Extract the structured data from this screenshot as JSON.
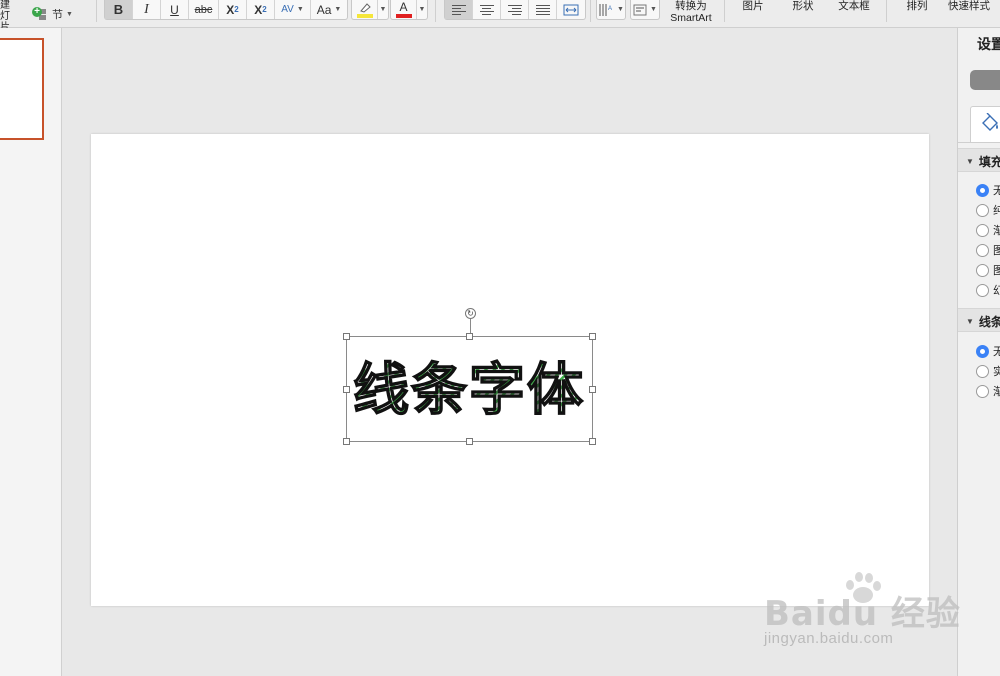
{
  "ribbon": {
    "new_slide_label_1": "建",
    "new_slide_label_2": "灯片",
    "section_label": "节",
    "format": {
      "bold": "B",
      "italic": "I",
      "underline": "U",
      "strikethrough": "abc",
      "superscript": "X",
      "superscript_mark": "2",
      "subscript": "X",
      "subscript_mark": "2",
      "char_spacing": "AV",
      "change_case": "Aa"
    },
    "highlight_color": "#f5e63a",
    "font_color": "#e02020",
    "font_color_glyph": "A",
    "convert_smartart_1": "转换为",
    "convert_smartart_2": "SmartArt",
    "picture": "图片",
    "shape": "形状",
    "textbox": "文本框",
    "arrange": "排列",
    "quick_styles": "快速样式"
  },
  "slide": {
    "text": "线条字体",
    "fill_color": "#3fae4a",
    "stroke_color": "#111111"
  },
  "pane": {
    "title": "设置",
    "fill_section": "填充",
    "fill_options": [
      "无",
      "纯",
      "渐",
      "图",
      "图",
      "幻"
    ],
    "fill_selected": 0,
    "line_section": "线条",
    "line_options": [
      "无",
      "实",
      "渐"
    ],
    "line_selected": 0
  },
  "watermark": {
    "brand": "Baidu 经验",
    "url": "jingyan.baidu.com"
  }
}
